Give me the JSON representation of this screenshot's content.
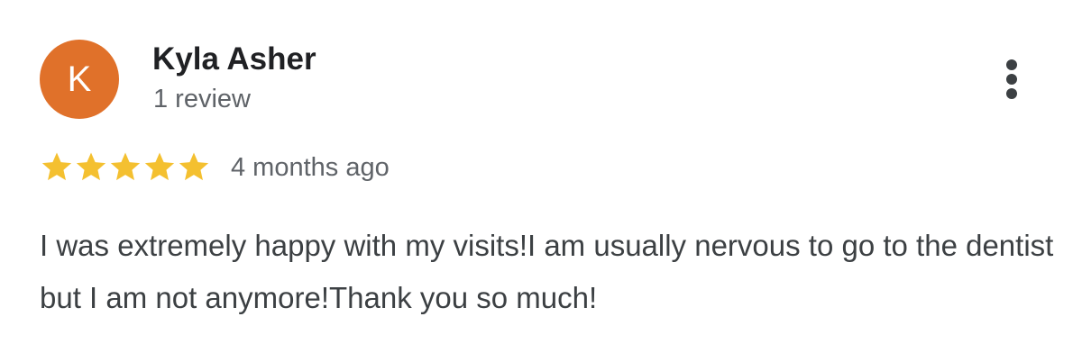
{
  "review": {
    "author": {
      "name": "Kyla Asher",
      "initial": "K",
      "review_count": "1 review",
      "avatar_color": "#E0712A"
    },
    "rating": {
      "value": 5,
      "max": 5,
      "star_color": "#F4C030",
      "icon": "star-icon"
    },
    "timestamp": "4 months ago",
    "text": "I was extremely happy with my visits!I am usually nervous to go to the dentist but I am not anymore!Thank you so much!",
    "more_options_icon": "more-vert-icon"
  }
}
